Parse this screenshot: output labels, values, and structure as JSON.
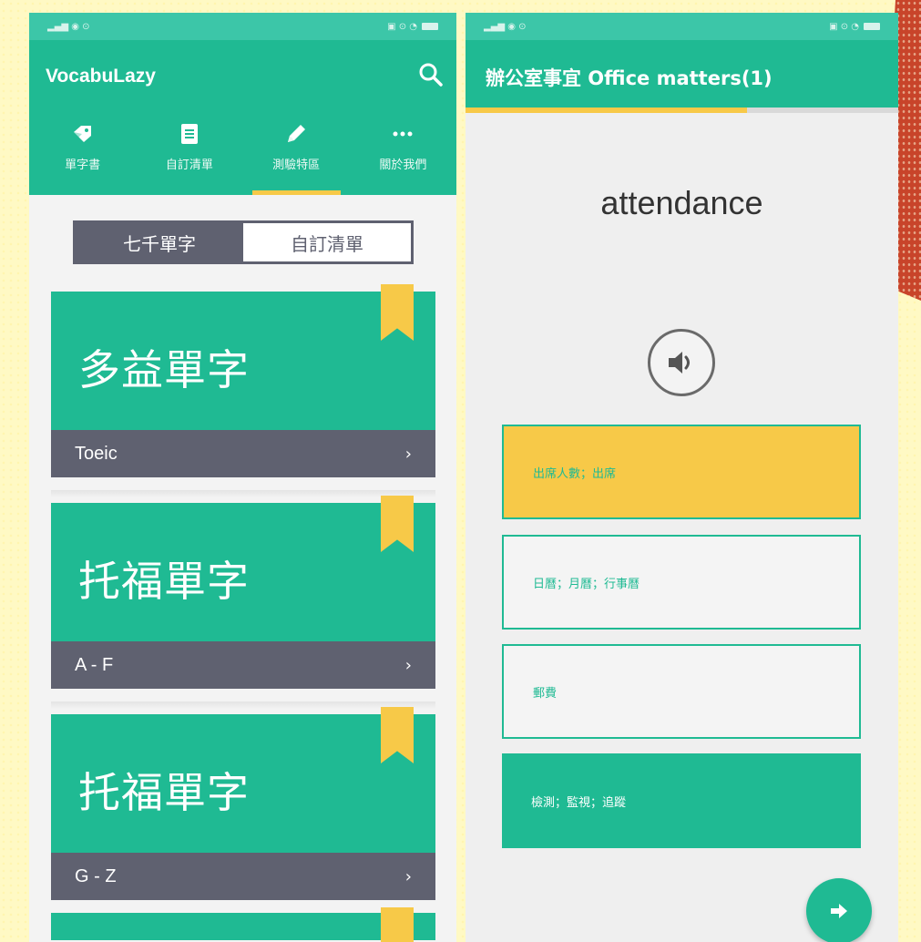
{
  "left": {
    "app_title": "VocabuLazy",
    "tabs": [
      {
        "label": "單字書",
        "icon": "tag-icon",
        "active": false
      },
      {
        "label": "自訂清單",
        "icon": "list-icon",
        "active": false
      },
      {
        "label": "測驗特區",
        "icon": "pencil-icon",
        "active": true
      },
      {
        "label": "關於我們",
        "icon": "more-icon",
        "active": false
      }
    ],
    "segment": [
      {
        "label": "七千單字",
        "selected": false
      },
      {
        "label": "自訂清單",
        "selected": true
      }
    ],
    "cards": [
      {
        "title": "多益單字",
        "subtitle": "Toeic"
      },
      {
        "title": "托福單字",
        "subtitle": "A - F"
      },
      {
        "title": "托福單字",
        "subtitle": "G - Z"
      }
    ],
    "chevron": "›"
  },
  "right": {
    "quiz_title": "辦公室事宜 Office matters(1)",
    "progress_fraction": 0.65,
    "word": "attendance",
    "options": [
      {
        "text": "出席人數；出席",
        "state": "selected"
      },
      {
        "text": "日曆；月曆；行事曆",
        "state": "outlined"
      },
      {
        "text": "郵費",
        "state": "outlined"
      },
      {
        "text": "檢測；監視；追蹤",
        "state": "filled"
      }
    ]
  },
  "colors": {
    "primary": "#1fba93",
    "accent": "#f7c948",
    "dark": "#5f6170"
  }
}
